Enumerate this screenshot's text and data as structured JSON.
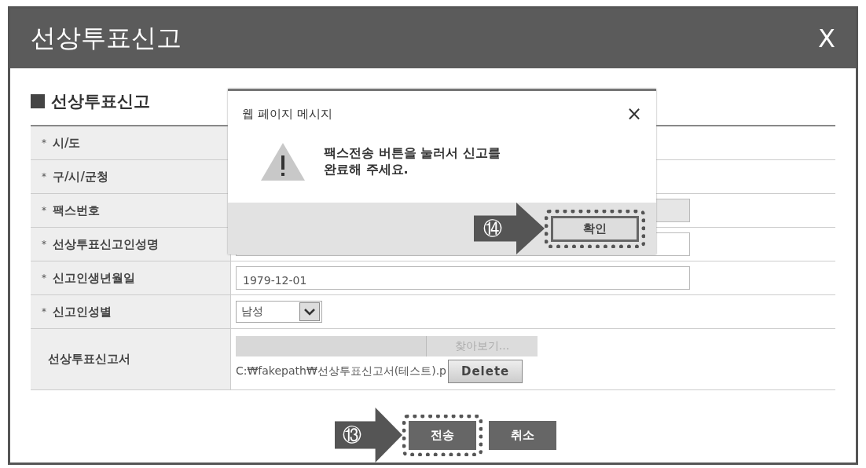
{
  "window": {
    "title": "선상투표신고",
    "close": "X"
  },
  "section_title": "선상투표신고",
  "form_rows": [
    {
      "kind": "empty",
      "mark": "*",
      "label": "시/도"
    },
    {
      "kind": "empty",
      "mark": "*",
      "label": "구/시/군청"
    },
    {
      "kind": "input",
      "mark": "*",
      "label": "팩스번호",
      "disabled": true
    },
    {
      "kind": "input",
      "mark": "*",
      "label": "선상투표신고인성명",
      "disabled": false
    },
    {
      "kind": "input",
      "mark": "*",
      "label": "신고인생년월일",
      "value": "1979-12-01",
      "disabled": false
    },
    {
      "kind": "select",
      "mark": "*",
      "label": "신고인성별",
      "value": "남성"
    },
    {
      "kind": "file",
      "label": "선상투표신고서",
      "browse": "찾아보기...",
      "path": "C:₩fakepath₩선상투표신고서(테스트).p",
      "delete": "Delete"
    }
  ],
  "buttons": [
    {
      "label": "전송",
      "highlighted": true
    },
    {
      "label": "취소",
      "highlighted": false
    }
  ],
  "step_callout": "⑬",
  "dialog": {
    "title": "웹 페이지 메시지",
    "close": "×",
    "message": "팩스전송 버튼을 눌러서 신고를\n완료해 주세요.",
    "ok": {
      "label": "확인",
      "highlighted": true
    },
    "step_callout": "⑭"
  }
}
